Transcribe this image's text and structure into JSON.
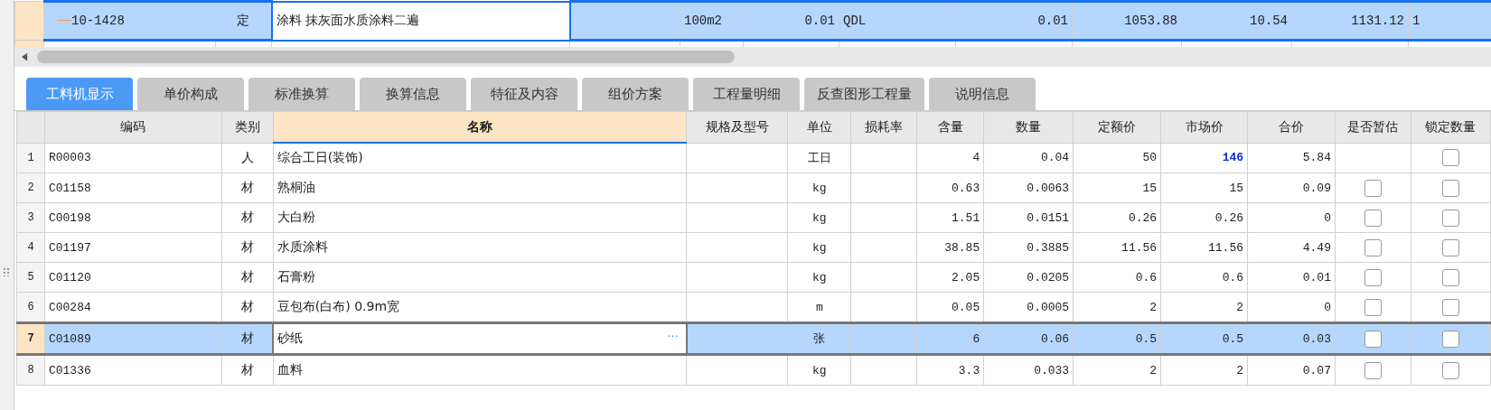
{
  "upper_table": {
    "rows": [
      {
        "selected": true,
        "cells": [
          "10-1428",
          "定",
          "涂料 抹灰面水质涂料二遍",
          "",
          "100m2",
          "0.01",
          "QDL",
          "0.01",
          "1053.88",
          "10.54",
          "1131.12",
          "1"
        ]
      }
    ]
  },
  "tabs": [
    {
      "label": "工料机显示",
      "selected": true
    },
    {
      "label": "单价构成",
      "selected": false
    },
    {
      "label": "标准换算",
      "selected": false
    },
    {
      "label": "换算信息",
      "selected": false
    },
    {
      "label": "特征及内容",
      "selected": false
    },
    {
      "label": "组价方案",
      "selected": false
    },
    {
      "label": "工程量明细",
      "selected": false
    },
    {
      "label": "反查图形工程量",
      "selected": false
    },
    {
      "label": "说明信息",
      "selected": false
    }
  ],
  "table": {
    "editor_button": "···",
    "columns": [
      {
        "label": "编码",
        "selected": false
      },
      {
        "label": "类别",
        "selected": false
      },
      {
        "label": "名称",
        "selected": true
      },
      {
        "label": "规格及型号",
        "selected": false
      },
      {
        "label": "单位",
        "selected": false
      },
      {
        "label": "损耗率",
        "selected": false
      },
      {
        "label": "含量",
        "selected": false
      },
      {
        "label": "数量",
        "selected": false
      },
      {
        "label": "定额价",
        "selected": false
      },
      {
        "label": "市场价",
        "selected": false
      },
      {
        "label": "合价",
        "selected": false
      },
      {
        "label": "是否暂估",
        "selected": false
      },
      {
        "label": "锁定数量",
        "selected": false
      }
    ],
    "rows": [
      {
        "number": "1",
        "code": "R00003",
        "type": "人",
        "name": "综合工日(装饰)",
        "unit": "工日",
        "content": "4",
        "quantity": "0.04",
        "quota_price": "50",
        "market_price": "146",
        "market_price_modified": true,
        "total": "5.84",
        "lock_checked": false,
        "selected": false
      },
      {
        "number": "2",
        "code": "C01158",
        "type": "材",
        "name": "熟桐油",
        "unit": "kg",
        "content": "0.63",
        "quantity": "0.0063",
        "quota_price": "15",
        "market_price": "15",
        "market_price_modified": false,
        "total": "0.09",
        "provisional_checked": false,
        "lock_checked": false,
        "selected": false
      },
      {
        "number": "3",
        "code": "C00198",
        "type": "材",
        "name": "大白粉",
        "unit": "kg",
        "content": "1.51",
        "quantity": "0.0151",
        "quota_price": "0.26",
        "market_price": "0.26",
        "market_price_modified": false,
        "total": "0",
        "provisional_checked": false,
        "lock_checked": false,
        "selected": false
      },
      {
        "number": "4",
        "code": "C01197",
        "type": "材",
        "name": "水质涂料",
        "unit": "kg",
        "content": "38.85",
        "quantity": "0.3885",
        "quota_price": "11.56",
        "market_price": "11.56",
        "market_price_modified": false,
        "total": "4.49",
        "provisional_checked": false,
        "lock_checked": false,
        "selected": false
      },
      {
        "number": "5",
        "code": "C01120",
        "type": "材",
        "name": "石膏粉",
        "unit": "kg",
        "content": "2.05",
        "quantity": "0.0205",
        "quota_price": "0.6",
        "market_price": "0.6",
        "market_price_modified": false,
        "total": "0.01",
        "provisional_checked": false,
        "lock_checked": false,
        "selected": false
      },
      {
        "number": "6",
        "code": "C00284",
        "type": "材",
        "name": "豆包布(白布) 0.9m宽",
        "unit": "m",
        "content": "0.05",
        "quantity": "0.0005",
        "quota_price": "2",
        "market_price": "2",
        "market_price_modified": false,
        "total": "0",
        "provisional_checked": false,
        "lock_checked": false,
        "selected": false
      },
      {
        "number": "7",
        "code": "C01089",
        "type": "材",
        "name": "砂纸",
        "unit": "张",
        "content": "6",
        "quantity": "0.06",
        "quota_price": "0.5",
        "market_price": "0.5",
        "market_price_modified": false,
        "total": "0.03",
        "provisional_checked": false,
        "lock_checked": false,
        "selected": true
      },
      {
        "number": "8",
        "code": "C01336",
        "type": "材",
        "name": "血料",
        "unit": "kg",
        "content": "3.3",
        "quantity": "0.033",
        "quota_price": "2",
        "market_price": "2",
        "market_price_modified": false,
        "total": "0.07",
        "provisional_checked": false,
        "lock_checked": false,
        "selected": false
      }
    ]
  }
}
